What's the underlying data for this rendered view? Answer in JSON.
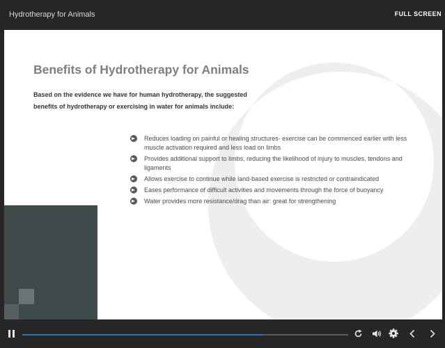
{
  "topbar": {
    "course_title": "Hydrotherapy for Animals",
    "fullscreen_label": "FULL SCREEN"
  },
  "slide": {
    "heading": "Benefits of Hydrotherapy for Animals",
    "intro": "Based on the evidence we have for human hydrotherapy, the suggested benefits of hydrotherapy or exercising in water for animals include:",
    "bullets": [
      "Reduces loading on painful or healing structures- exercise can be commenced earlier with less muscle activation required and less load on limbs",
      "Provides additional support to limbs, reducing the likelihood of injury to muscles, tendons and ligaments",
      "Allows exercise to continue while land-based exercise is restricted or contraindicated",
      "Eases performance of difficult activities and movements through the force of buoyancy",
      "Water provides more resistance/drag than air: great for strengthening"
    ],
    "bullet_icon": "arrow-circle-icon"
  },
  "player": {
    "progress": 0.74,
    "accent_color": "#2f6fbf",
    "icons": [
      "pause-icon",
      "replay-icon",
      "volume-icon",
      "gear-icon",
      "chevron-left-icon",
      "chevron-right-icon"
    ]
  }
}
